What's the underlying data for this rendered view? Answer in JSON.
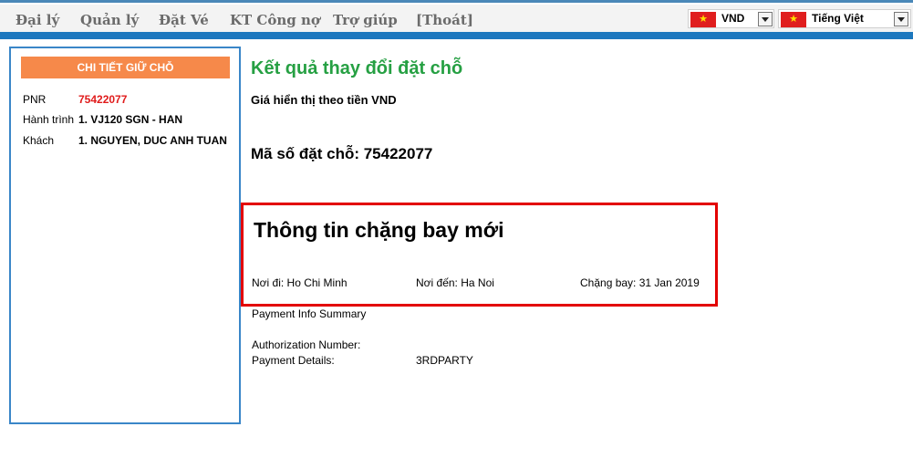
{
  "nav": {
    "items": [
      "Đại lý",
      "Quản lý",
      "Đặt Vé",
      "KT Công nợ",
      "Trợ giúp",
      "[Thoát]"
    ],
    "currency": {
      "value": "VND",
      "flag_icon": "vietnam-flag-icon"
    },
    "language": {
      "value": "Tiếng Việt",
      "flag_icon": "vietnam-flag-icon"
    }
  },
  "sidebar": {
    "header": "CHI TIẾT GIỮ CHỖ",
    "pnr_label": "PNR",
    "pnr_value": "75422077",
    "route_label": "Hành trình",
    "route_value": "1. VJ120 SGN - HAN",
    "passenger_label": "Khách",
    "passenger_value": "1. NGUYEN, DUC ANH TUAN"
  },
  "main": {
    "title": "Kết quả thay đổi đặt chỗ",
    "price_note": "Giá hiển thị theo tiền VND",
    "booking_code": "Mã số đặt chỗ: 75422077",
    "segment": {
      "title": "Thông tin chặng bay mới",
      "origin": "Nơi đi: Ho Chi Minh",
      "destination": "Nơi đến: Ha Noi",
      "date": "Chặng bay: 31 Jan 2019"
    },
    "payment": {
      "summary_label": "Payment Info Summary",
      "auth_label": "Authorization Number:",
      "details_label": "Payment Details:",
      "details_value": "3RDPARTY"
    }
  },
  "colors": {
    "accent_blue": "#1d78be",
    "header_orange": "#f6894a",
    "title_green": "#26a043",
    "highlight_red": "#e30000",
    "pnr_red": "#e01b1b"
  }
}
